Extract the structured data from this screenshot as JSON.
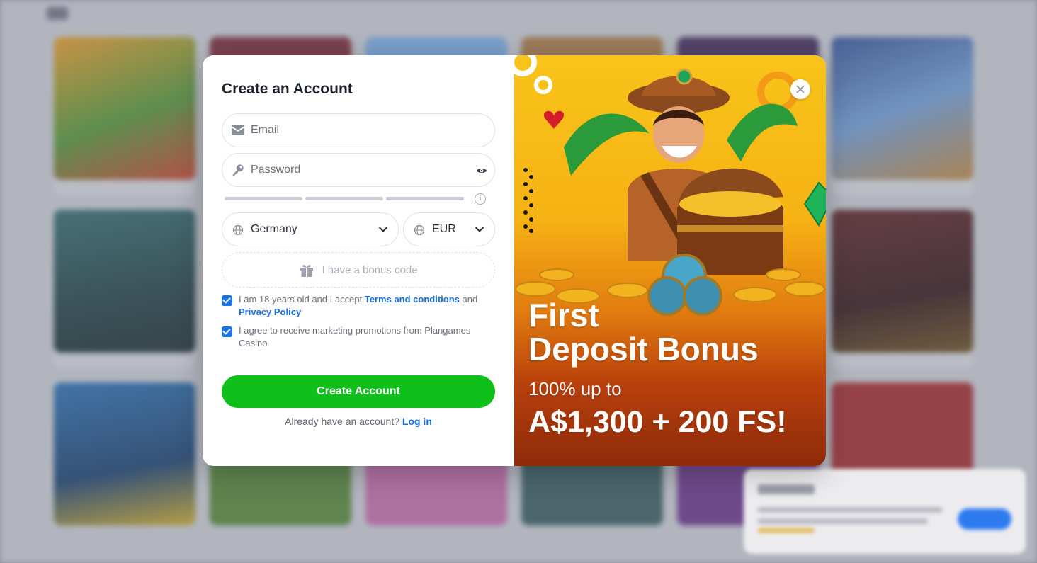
{
  "modal": {
    "title": "Create an Account",
    "email_placeholder": "Email",
    "password_placeholder": "Password",
    "country_value": "Germany",
    "currency_value": "EUR",
    "bonus_code_label": "I have a bonus code",
    "terms": {
      "prefix": "I am 18 years old and I accept",
      "terms_link": "Terms and conditions",
      "and": "and",
      "privacy_link": "Privacy Policy",
      "checked": true
    },
    "marketing": {
      "text": "I agree to receive marketing promotions from Plangames Casino",
      "checked": true
    },
    "submit_label": "Create Account",
    "login_prompt": "Already have an account?",
    "login_link": "Log in"
  },
  "promo": {
    "line1": "First",
    "line2": "Deposit Bonus",
    "line3": "100% up to",
    "line4": "A$1,300 + 200 FS!"
  },
  "colors": {
    "accent_green": "#0fbf1a",
    "link_blue": "#1a6fe0",
    "checkbox_blue": "#1a74e8",
    "promo_top": "#f9c41a",
    "promo_bottom": "#8d2a0a"
  },
  "icons": [
    "mail-icon",
    "key-icon",
    "eye-icon",
    "info-icon",
    "globe-icon",
    "chevron-down-icon",
    "gift-icon",
    "close-icon"
  ]
}
